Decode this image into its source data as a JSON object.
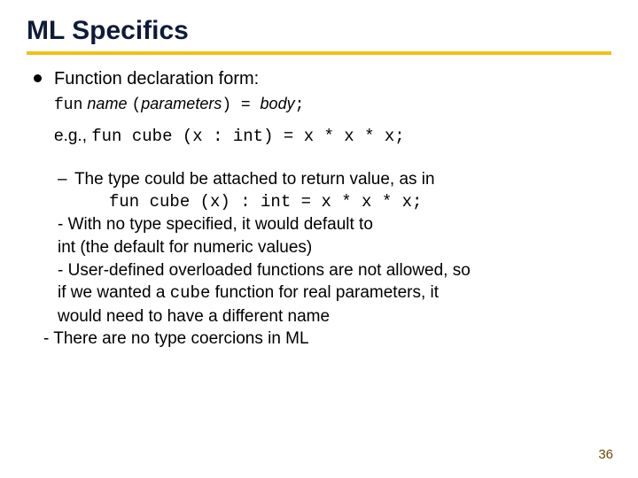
{
  "title": "ML Specifics",
  "main": {
    "heading": "Function declaration form:",
    "decl_fun": "fun",
    "decl_name": "name",
    "decl_open": " (",
    "decl_params": "parameters",
    "decl_close": ") = ",
    "decl_body": "body",
    "decl_semi": ";",
    "eg_prefix": "e.g., ",
    "eg_code": "fun cube (x : int) = x * x * x;"
  },
  "sub": {
    "l1": "The type could be attached to return value, as in",
    "l2": "fun cube (x) : int = x * x * x;",
    "l3": "- With no type specified, it would default to",
    "l4": " int (the default for numeric values)",
    "l5": "- User-defined overloaded functions are not allowed, so",
    "l6a": "if we wanted a ",
    "l6b": "cube",
    "l6c": " function for real parameters, it",
    "l7": "would need to have a different name",
    "l8": "- There are no type coercions in ML"
  },
  "page": "36"
}
